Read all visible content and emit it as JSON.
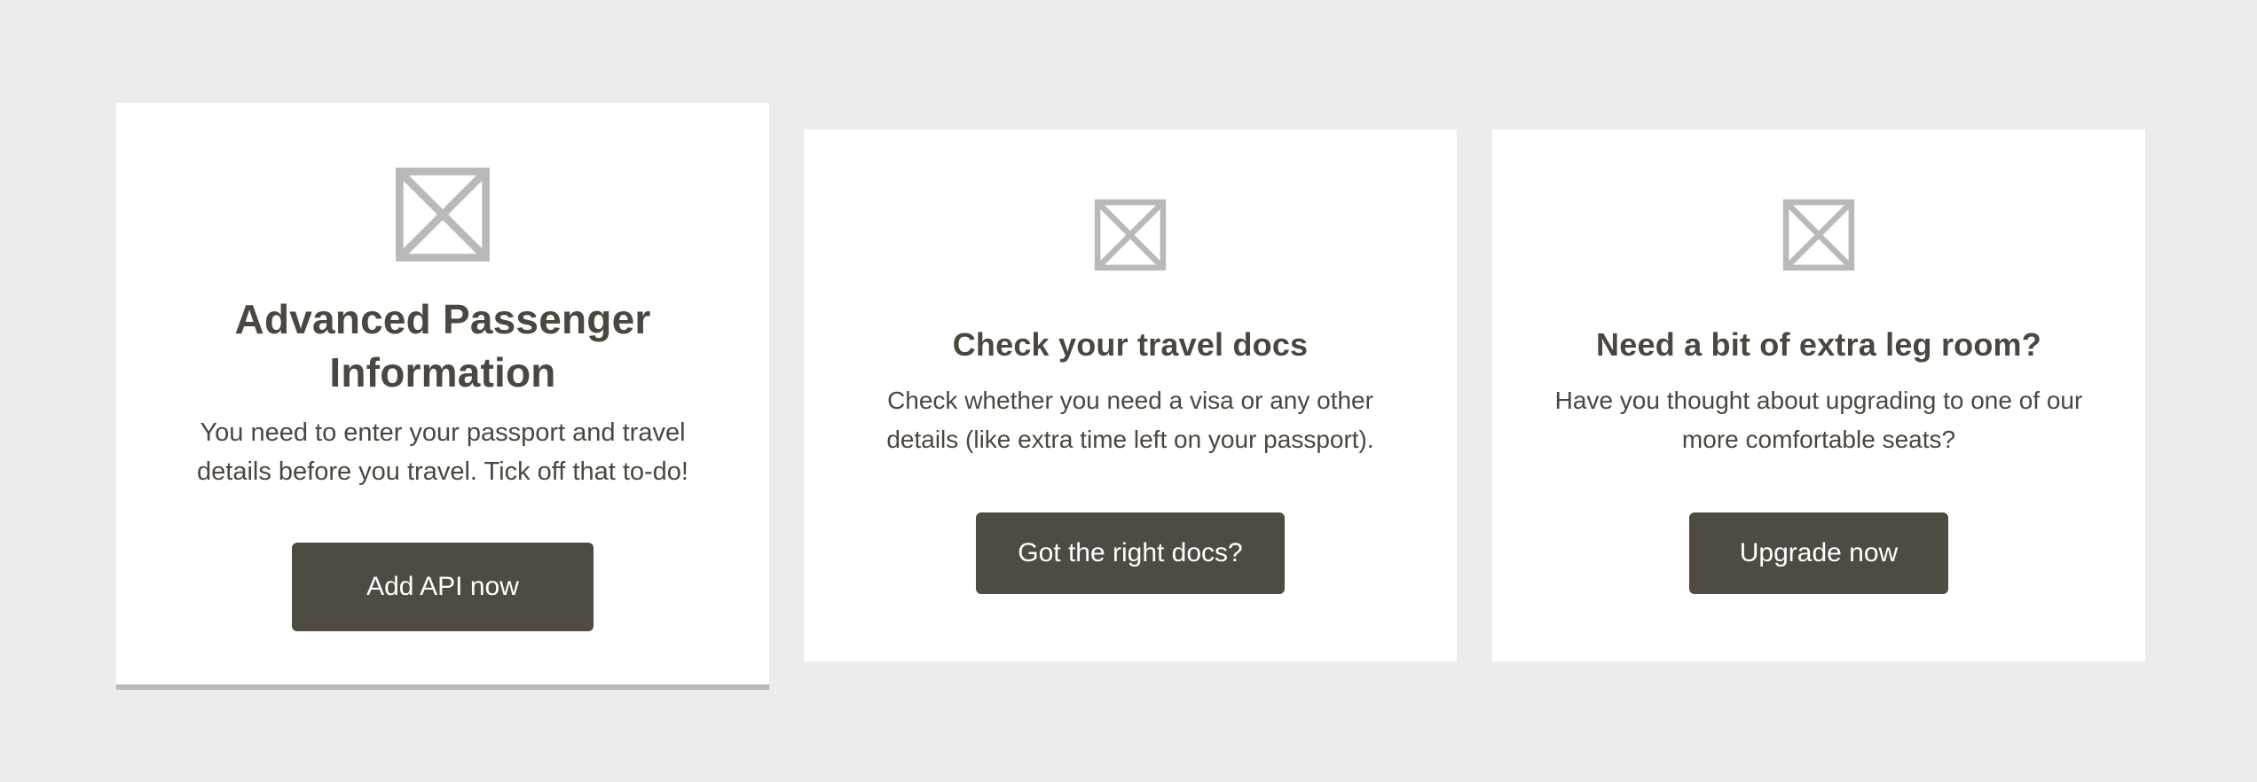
{
  "cards": [
    {
      "icon": "image-placeholder-icon",
      "title": "Advanced Passenger Information",
      "description": "You need to enter your passport and travel details before you travel. Tick off that to-do!",
      "button_label": "Add API now"
    },
    {
      "icon": "image-placeholder-icon",
      "title": "Check your travel docs",
      "description": "Check whether you need a visa or any other details (like extra time left on your passport).",
      "button_label": "Got the right docs?"
    },
    {
      "icon": "image-placeholder-icon",
      "title": "Need a bit of extra leg room?",
      "description": "Have you thought about upgrading to one of our more comfortable seats?",
      "button_label": "Upgrade now"
    }
  ],
  "colors": {
    "background": "#ececec",
    "card": "#ffffff",
    "text": "#4b463f",
    "button": "#4f4b43",
    "button_text": "#ffffff",
    "placeholder_icon": "#b9b9b9",
    "featured_border": "#b9b9b9"
  }
}
